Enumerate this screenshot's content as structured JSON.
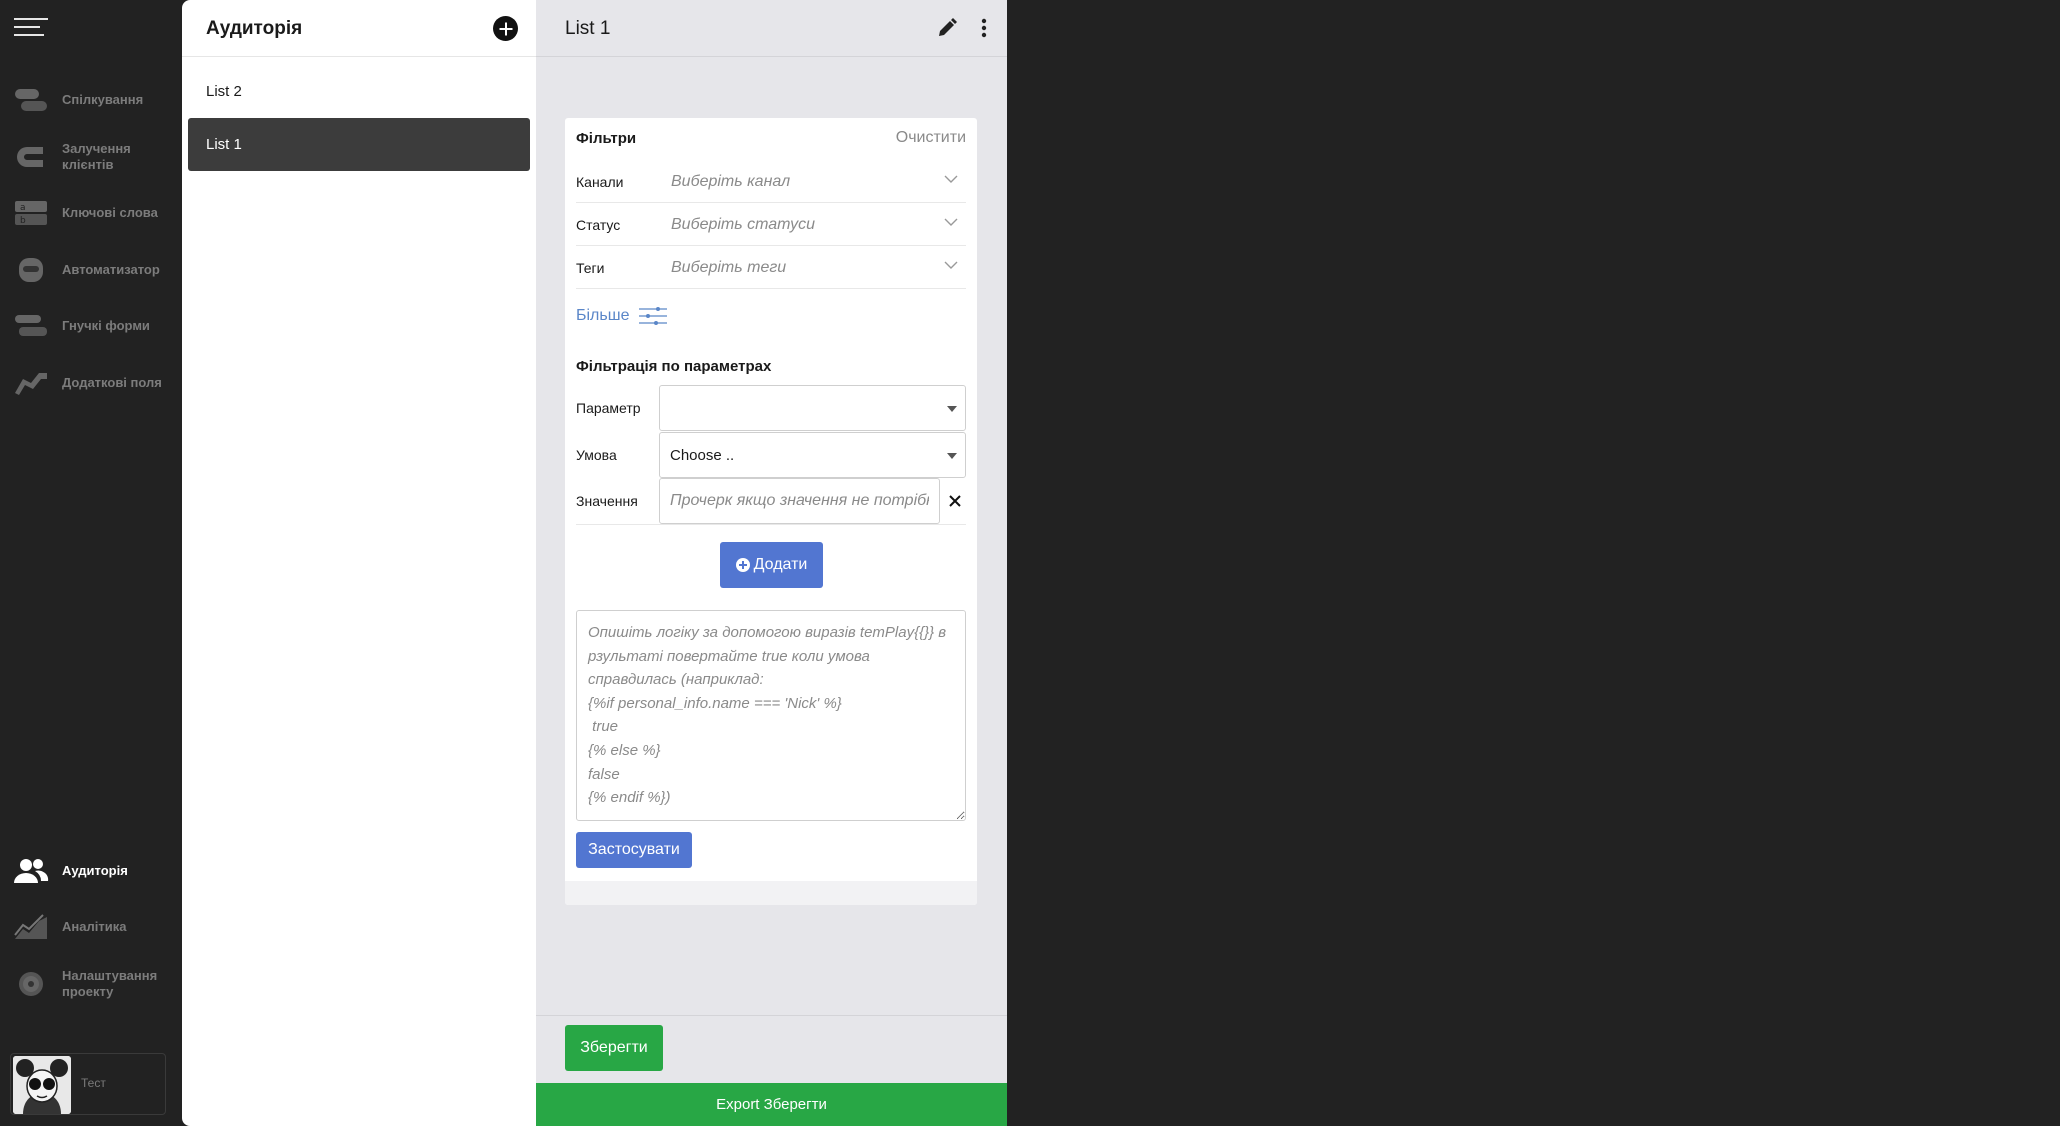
{
  "nav": {
    "items": [
      {
        "label": "Спілкування",
        "icon": "chat-bubbles-icon"
      },
      {
        "label": "Залучення клієнтів",
        "icon": "magnet-icon"
      },
      {
        "label": "Ключові слова",
        "icon": "keywords-icon"
      },
      {
        "label": "Автоматизатор",
        "icon": "robot-icon"
      },
      {
        "label": "Гнучкі форми",
        "icon": "forms-icon"
      },
      {
        "label": "Додаткові поля",
        "icon": "fields-icon"
      }
    ],
    "bottom_items": [
      {
        "label": "Аудиторія",
        "icon": "users-icon"
      },
      {
        "label": "Аналітика",
        "icon": "analytics-icon"
      },
      {
        "label": "Налаштування проекту",
        "icon": "gear-icon"
      }
    ],
    "user": {
      "name": "Тест"
    }
  },
  "audience": {
    "title": "Аудиторія",
    "lists": [
      {
        "label": "List 2"
      },
      {
        "label": "List 1"
      }
    ]
  },
  "detail": {
    "title": "List 1",
    "filters": {
      "title": "Фільтри",
      "clear_label": "Очистити",
      "rows": [
        {
          "label": "Канали",
          "placeholder": "Виберіть канал"
        },
        {
          "label": "Статус",
          "placeholder": "Виберіть статуси"
        },
        {
          "label": "Теги",
          "placeholder": "Виберіть теги"
        }
      ],
      "more_label": "Більше"
    },
    "params": {
      "title": "Фільтрація по параметрах",
      "parameter_label": "Параметр",
      "parameter_value": "",
      "condition_label": "Умова",
      "condition_value": "Choose ..",
      "value_label": "Значення",
      "value_placeholder": "Прочерк якщо значення не потрібне",
      "add_label": "Додати"
    },
    "logic_placeholder": "Опишіть логіку за допомогою виразів temPlay{{}} в рзультаті повертайте true коли умова справдилась (наприклад:\n{%if personal_info.name === 'Nick' %}\n true\n{% else %}\nfalse\n{% endif %})",
    "apply_label": "Застосувати",
    "save_label": "Зберегти",
    "export_label": "Export Зберегти"
  },
  "colors": {
    "accent_blue": "#5276d1",
    "save_green": "#28a745",
    "nav_bg": "#222222"
  }
}
